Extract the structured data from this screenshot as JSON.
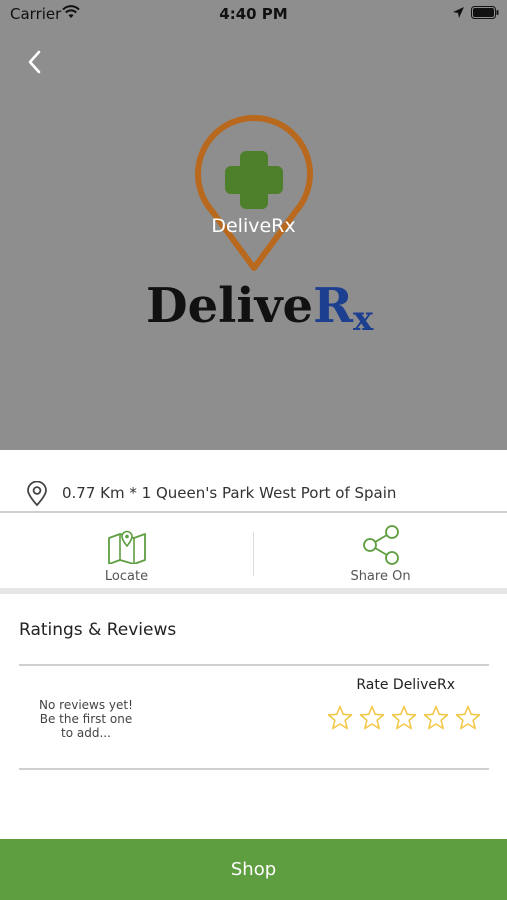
{
  "status_bar": {
    "carrier": "Carrier",
    "time": "4:40 PM"
  },
  "store": {
    "name_overlay": "DeliveRx",
    "wordmark_main": "Delive",
    "wordmark_r": "R",
    "wordmark_x": "x"
  },
  "address": {
    "text": "0.77 Km * 1 Queen's Park West Port of Spain"
  },
  "actions": {
    "locate_label": "Locate",
    "share_label": "Share On"
  },
  "reviews": {
    "title": "Ratings & Reviews",
    "empty_line1": "No reviews yet!",
    "empty_line2": "Be the first one",
    "empty_line3": "to add...",
    "rate_label": "Rate DeliveRx"
  },
  "footer": {
    "shop_label": "Shop"
  },
  "colors": {
    "hero_bg": "#8e8e8e",
    "accent_green": "#5f9e40",
    "pin_brown": "#b8691e",
    "cross_green": "#4e7f2b",
    "rx_blue": "#1d3f8f",
    "star_yellow": "#f2c84b"
  },
  "icons": {
    "back": "chevron-left-icon",
    "pin": "location-pin-icon",
    "map": "map-icon",
    "share": "share-icon",
    "star": "star-outline-icon"
  }
}
